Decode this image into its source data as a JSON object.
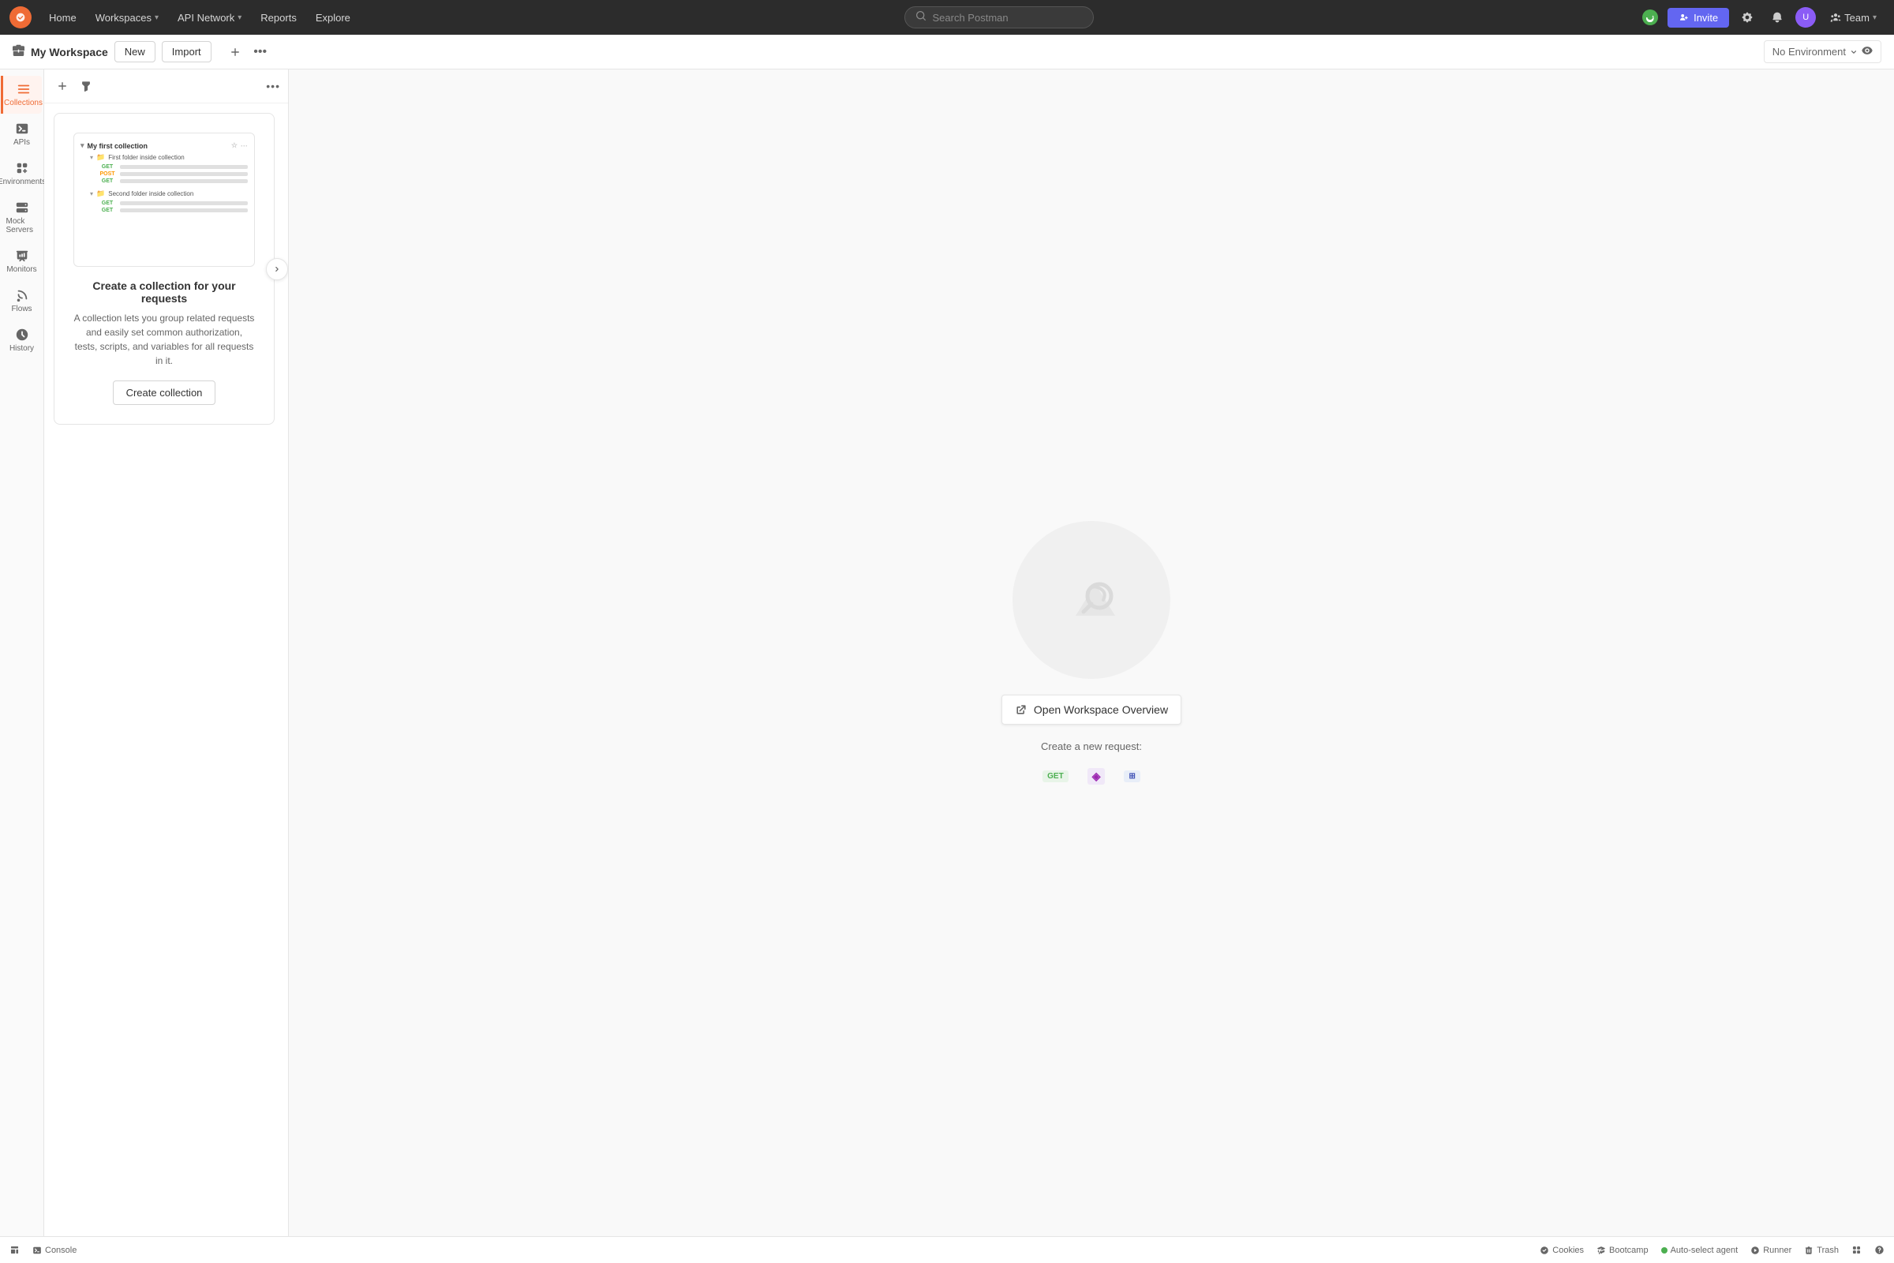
{
  "app": {
    "name": "Postman"
  },
  "topnav": {
    "home": "Home",
    "workspaces": "Workspaces",
    "api_network": "API Network",
    "reports": "Reports",
    "explore": "Explore",
    "search_placeholder": "Search Postman",
    "invite_label": "Invite",
    "team_label": "Team"
  },
  "workspace_bar": {
    "title": "My Workspace",
    "new_label": "New",
    "import_label": "Import",
    "env_label": "No Environment"
  },
  "sidebar": {
    "items": [
      {
        "id": "collections",
        "label": "Collections",
        "active": true
      },
      {
        "id": "apis",
        "label": "APIs",
        "active": false
      },
      {
        "id": "environments",
        "label": "Environments",
        "active": false
      },
      {
        "id": "mock-servers",
        "label": "Mock Servers",
        "active": false
      },
      {
        "id": "monitors",
        "label": "Monitors",
        "active": false
      },
      {
        "id": "flows",
        "label": "Flows",
        "active": false
      },
      {
        "id": "history",
        "label": "History",
        "active": false
      }
    ]
  },
  "collections_panel": {
    "preview": {
      "collection_name": "My first collection",
      "folder1": "First folder inside collection",
      "folder2": "Second folder inside collection"
    }
  },
  "main": {
    "promo_title": "Create a collection for your requests",
    "promo_desc": "A collection lets you group related requests and easily set common authorization, tests, scripts, and variables for all requests in it.",
    "create_collection_btn": "Create collection",
    "open_workspace_btn": "Open Workspace Overview",
    "new_request_label": "Create a new request:"
  },
  "bottom_bar": {
    "console": "Console",
    "cookies": "Cookies",
    "bootcamp": "Bootcamp",
    "auto_select_agent": "Auto-select agent",
    "runner": "Runner",
    "trash": "Trash"
  }
}
